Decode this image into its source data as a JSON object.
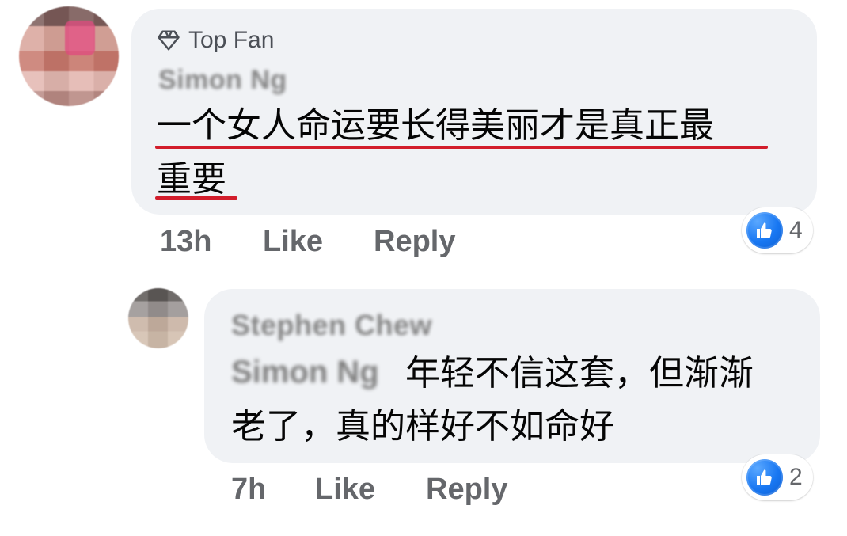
{
  "comments": [
    {
      "badge": {
        "label": "Top Fan",
        "icon": "diamond-icon"
      },
      "author": "Simon Ng",
      "text_lines": [
        "一个女人命运要长得美丽才是真正最",
        "重要"
      ],
      "meta": {
        "time": "13h",
        "like_label": "Like",
        "reply_label": "Reply"
      },
      "reactions": {
        "icon": "thumbs-up-icon",
        "count": "4"
      }
    },
    {
      "author": "Stephen Chew",
      "mention": "Simon Ng",
      "text_lines": [
        "年轻不信这套，但渐渐",
        "老了，真的样好不如命好"
      ],
      "meta": {
        "time": "7h",
        "like_label": "Like",
        "reply_label": "Reply"
      },
      "reactions": {
        "icon": "thumbs-up-icon",
        "count": "2"
      }
    }
  ],
  "colors": {
    "bubble_bg": "#f0f2f5",
    "text_primary": "#050505",
    "text_secondary": "#65676b",
    "underline_red": "#d21d2b",
    "like_blue": "#1877f2"
  }
}
